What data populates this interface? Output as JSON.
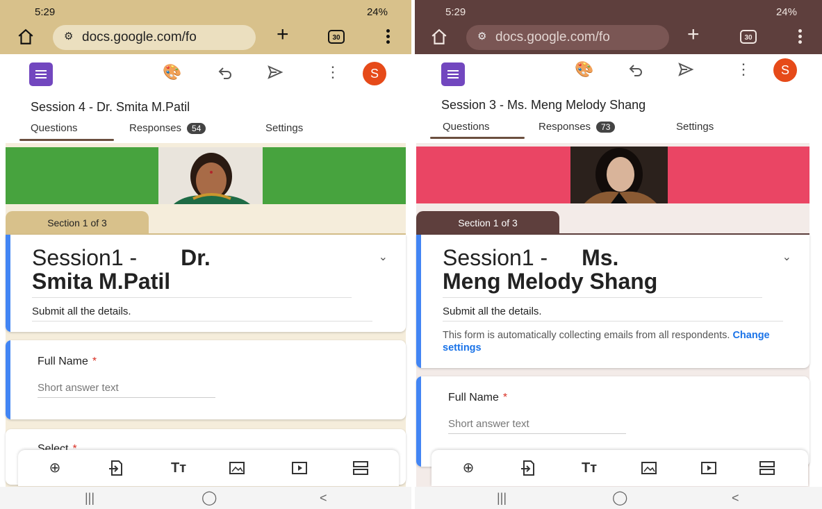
{
  "left": {
    "status": {
      "time": "5:29",
      "right": "24%"
    },
    "url": "docs.google.com/fo",
    "tab_count": "30",
    "avatar_letter": "S",
    "form_title": "Session 4 -  Dr. Smita M.Patil",
    "tabs": {
      "questions": "Questions",
      "responses": "Responses",
      "responses_count": "54",
      "settings": "Settings"
    },
    "section_label": "Section 1 of 3",
    "heading_light": "Session1 -",
    "heading_bold_1": "Dr.",
    "heading_bold_2": "Smita M.Patil",
    "description": "Submit all the details.",
    "question1": {
      "label": "Full Name",
      "required": "*",
      "hint": "Short answer text"
    },
    "question2": {
      "label": "Select",
      "required": "*"
    }
  },
  "right": {
    "status": {
      "time": "5:29",
      "right": "24%"
    },
    "url": "docs.google.com/fo",
    "tab_count": "30",
    "avatar_letter": "S",
    "form_title": "Session 3 -  Ms. Meng Melody Shang",
    "tabs": {
      "questions": "Questions",
      "responses": "Responses",
      "responses_count": "73",
      "settings": "Settings"
    },
    "section_label": "Section 1 of 3",
    "heading_light": "Session1 -",
    "heading_bold_1": "Ms.",
    "heading_bold_2": "Meng Melody Shang",
    "description": "Submit all the details.",
    "email_note": "This form is automatically collecting emails from all respondents.",
    "change_settings": "Change settings",
    "question1": {
      "label": "Full Name",
      "required": "*",
      "hint": "Short answer text"
    }
  },
  "icons": {
    "home": "home-icon",
    "tune": "site-info-icon",
    "plus": "new-tab-icon",
    "tabs": "tab-switcher-icon",
    "palette": "palette-icon",
    "undo": "undo-icon",
    "send": "send-icon",
    "more": "more-vert-icon",
    "add": "add-question-icon",
    "import": "import-questions-icon",
    "title": "add-title-icon",
    "image": "add-image-icon",
    "video": "add-video-icon",
    "section": "add-section-icon"
  },
  "colors": {
    "left_theme": "#d8c18b",
    "right_theme": "#5e3f3d",
    "accent": "#4285f4",
    "forms_purple": "#7247bf",
    "required": "#d93025"
  }
}
